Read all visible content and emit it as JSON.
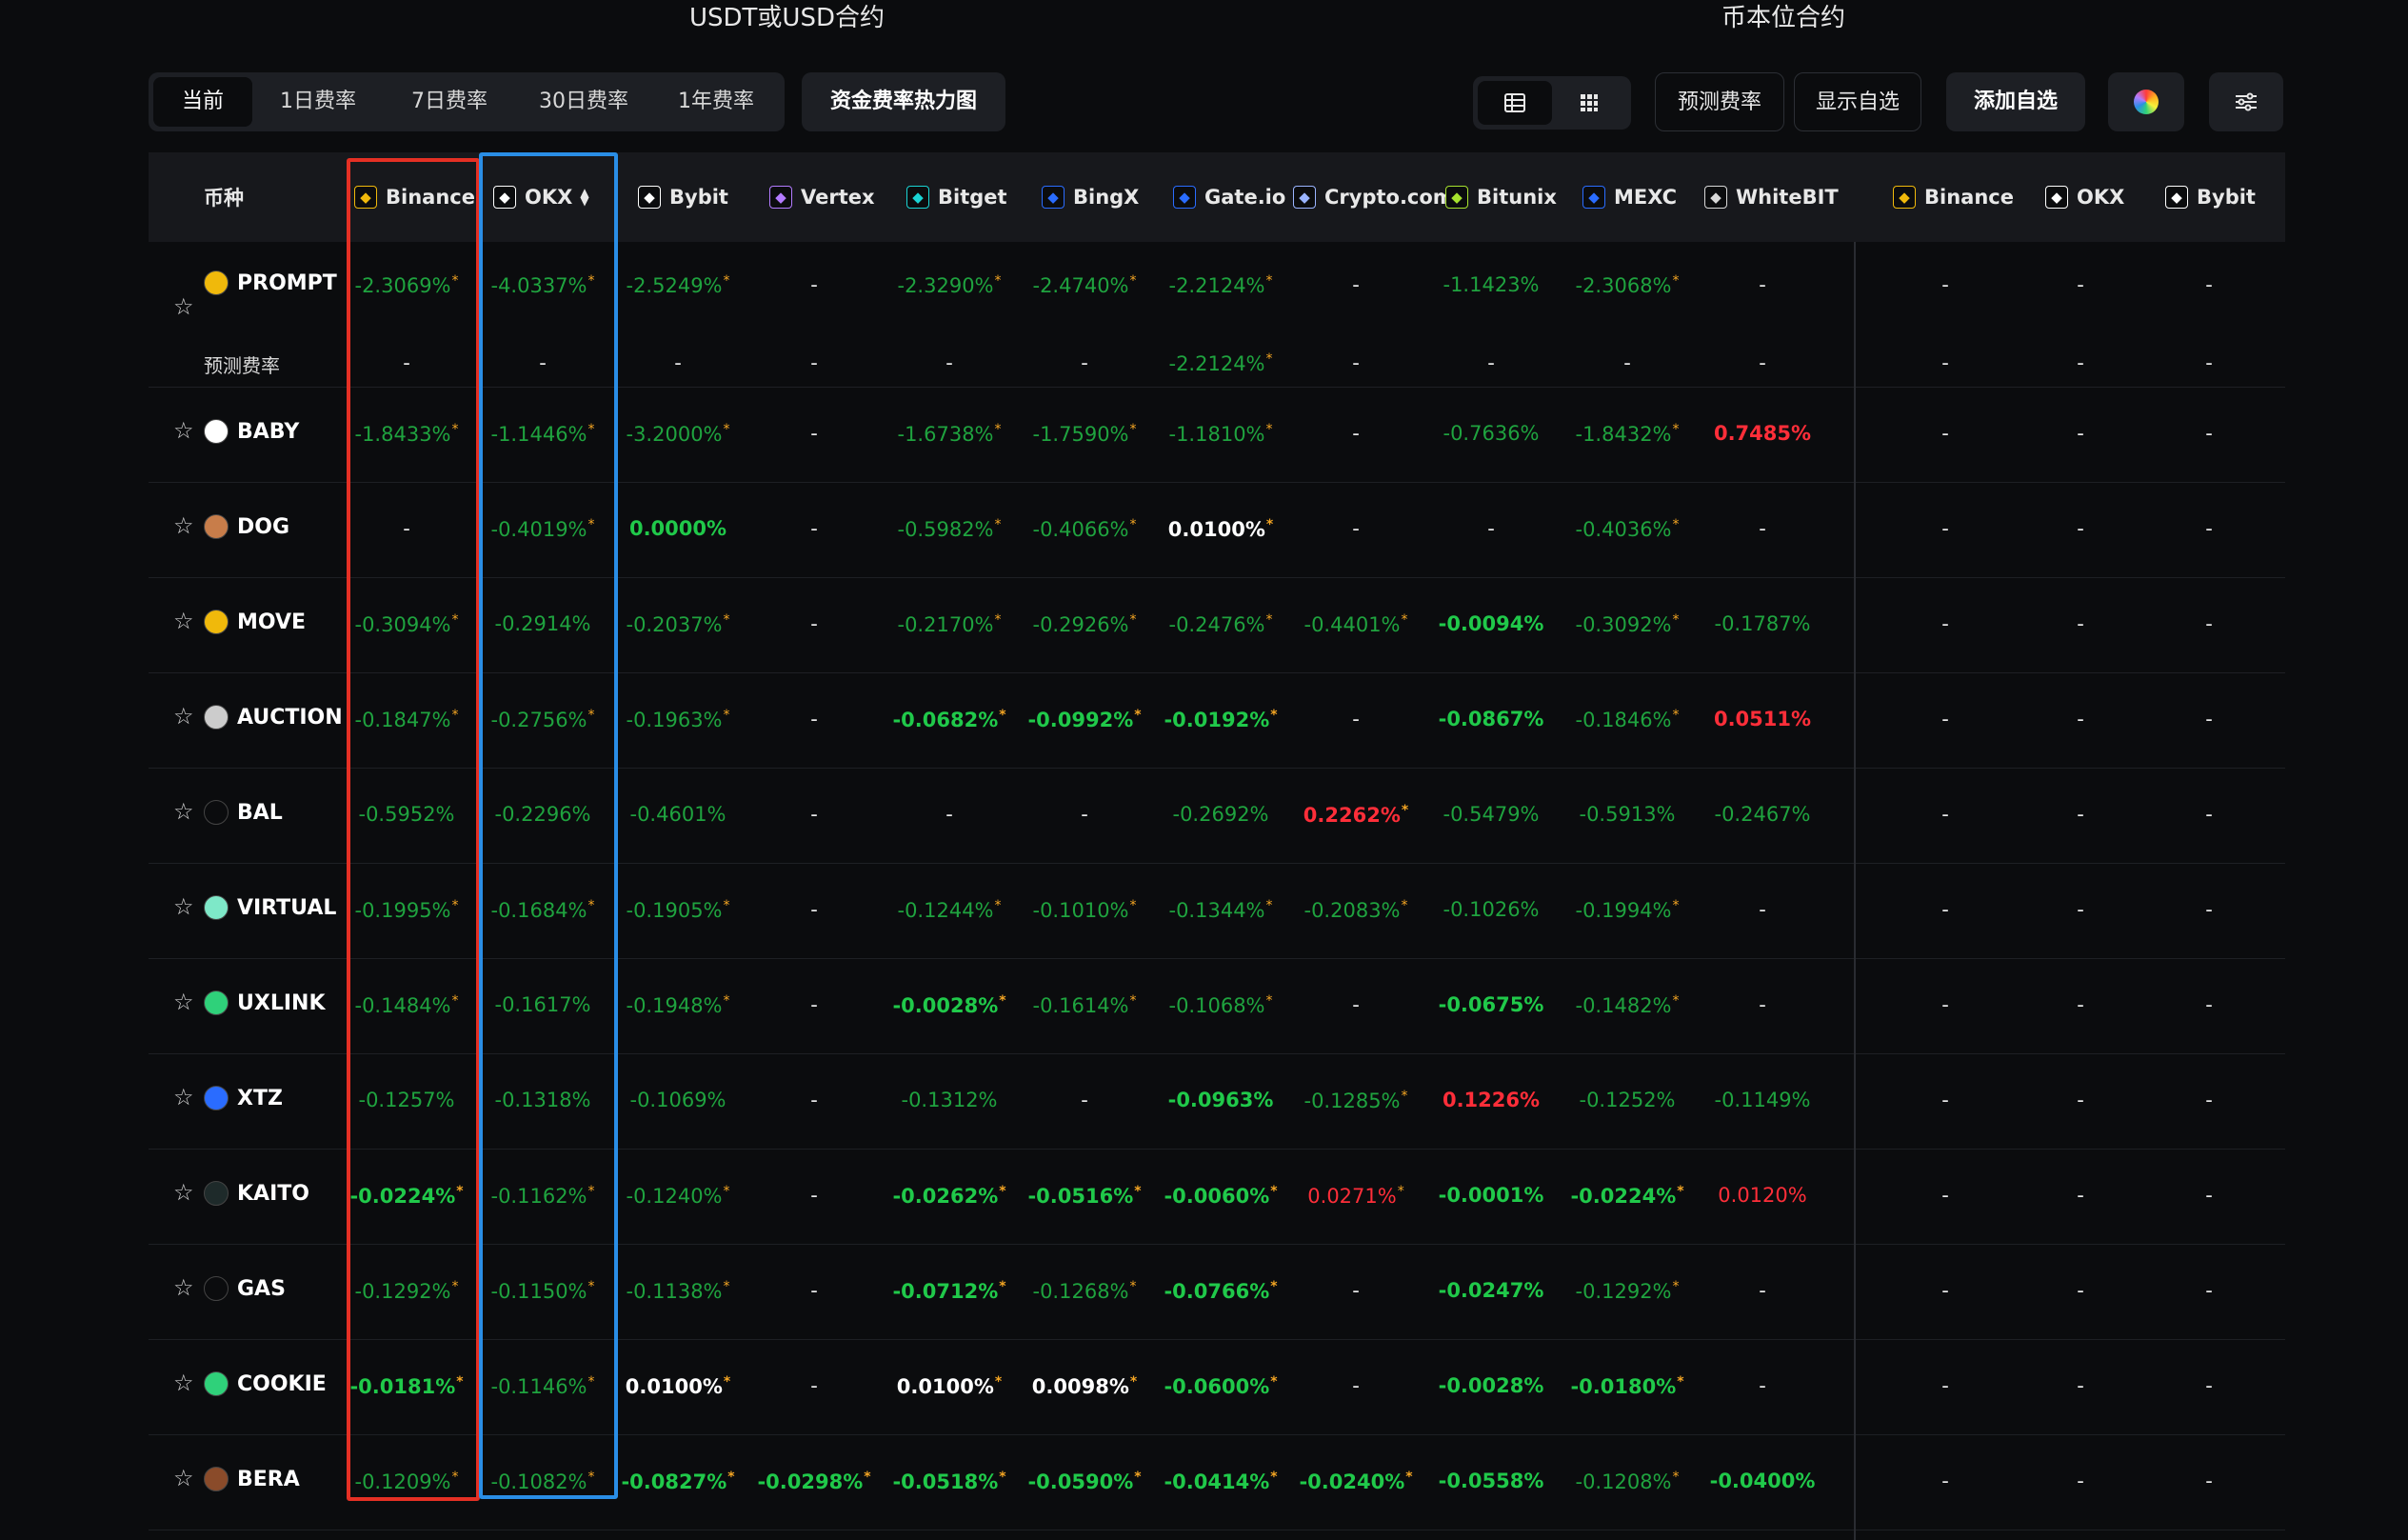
{
  "sections": {
    "usdt": "USDT或USD合约",
    "coin": "币本位合约"
  },
  "tabs": [
    "当前",
    "1日费率",
    "7日费率",
    "30日费率",
    "1年费率"
  ],
  "heatmap_button": "资金费率热力图",
  "buttons": {
    "predict": "预测费率",
    "show_fav": "显示自选",
    "add_fav": "添加自选"
  },
  "header": {
    "coin_label": "币种",
    "exchanges": [
      {
        "name": "Binance",
        "icon": "binance-icon",
        "color": "#f0b90b"
      },
      {
        "name": "OKX",
        "icon": "okx-icon",
        "color": "#ffffff"
      },
      {
        "name": "Bybit",
        "icon": "bybit-icon",
        "color": "#ffffff"
      },
      {
        "name": "Vertex",
        "icon": "vertex-icon",
        "color": "#b37bff"
      },
      {
        "name": "Bitget",
        "icon": "bitget-icon",
        "color": "#1ad4d4"
      },
      {
        "name": "BingX",
        "icon": "bingx-icon",
        "color": "#2a6cff"
      },
      {
        "name": "Gate.io",
        "icon": "gateio-icon",
        "color": "#2a6cff"
      },
      {
        "name": "Crypto.com",
        "icon": "cryptocom-icon",
        "color": "#9ab4ff"
      },
      {
        "name": "Bitunix",
        "icon": "bitunix-icon",
        "color": "#a6e22e"
      },
      {
        "name": "MEXC",
        "icon": "mexc-icon",
        "color": "#2a6cff"
      },
      {
        "name": "WhiteBIT",
        "icon": "whitebit-icon",
        "color": "#d8d8d8"
      },
      {
        "name": "Binance",
        "icon": "binance-icon",
        "color": "#f0b90b"
      },
      {
        "name": "OKX",
        "icon": "okx-icon",
        "color": "#ffffff"
      },
      {
        "name": "Bybit",
        "icon": "bybit-icon",
        "color": "#ffffff"
      }
    ]
  },
  "predict_label": "预测费率",
  "rows": [
    {
      "coin": "PROMPT",
      "icon": "prompt-icon",
      "icon_color": "#f0b90b",
      "values": [
        [
          "-2.3069%",
          "g",
          1
        ],
        [
          "-4.0337%",
          "g",
          1
        ],
        [
          "-2.5249%",
          "g",
          1
        ],
        [
          "-",
          "d",
          0
        ],
        [
          "-2.3290%",
          "g",
          1
        ],
        [
          "-2.4740%",
          "g",
          1
        ],
        [
          "-2.2124%",
          "g",
          1
        ],
        [
          "-",
          "d",
          0
        ],
        [
          "-1.1423%",
          "g",
          0
        ],
        [
          "-2.3068%",
          "g",
          1
        ],
        [
          "-",
          "d",
          0
        ],
        [
          "-",
          "d",
          0
        ],
        [
          "-",
          "d",
          0
        ],
        [
          "-",
          "d",
          0
        ]
      ],
      "predict": [
        [
          "-",
          "d",
          0
        ],
        [
          "-",
          "d",
          0
        ],
        [
          "-",
          "d",
          0
        ],
        [
          "-",
          "d",
          0
        ],
        [
          "-",
          "d",
          0
        ],
        [
          "-",
          "d",
          0
        ],
        [
          "-2.2124%",
          "g",
          1
        ],
        [
          "-",
          "d",
          0
        ],
        [
          "-",
          "d",
          0
        ],
        [
          "-",
          "d",
          0
        ],
        [
          "-",
          "d",
          0
        ],
        [
          "-",
          "d",
          0
        ],
        [
          "-",
          "d",
          0
        ],
        [
          "-",
          "d",
          0
        ]
      ]
    },
    {
      "coin": "BABY",
      "icon": "baby-icon",
      "icon_color": "#ffffff",
      "values": [
        [
          "-1.8433%",
          "g",
          1
        ],
        [
          "-1.1446%",
          "g",
          1
        ],
        [
          "-3.2000%",
          "g",
          1
        ],
        [
          "-",
          "d",
          0
        ],
        [
          "-1.6738%",
          "g",
          1
        ],
        [
          "-1.7590%",
          "g",
          1
        ],
        [
          "-1.1810%",
          "g",
          1
        ],
        [
          "-",
          "d",
          0
        ],
        [
          "-0.7636%",
          "g",
          0
        ],
        [
          "-1.8432%",
          "g",
          1
        ],
        [
          "0.7485%",
          "rb",
          0
        ],
        [
          "-",
          "d",
          0
        ],
        [
          "-",
          "d",
          0
        ],
        [
          "-",
          "d",
          0
        ]
      ]
    },
    {
      "coin": "DOG",
      "icon": "dog-icon",
      "icon_color": "#c87d4a",
      "values": [
        [
          "-",
          "d",
          0
        ],
        [
          "-0.4019%",
          "g",
          1
        ],
        [
          "0.0000%",
          "gb",
          0
        ],
        [
          "-",
          "d",
          0
        ],
        [
          "-0.5982%",
          "g",
          1
        ],
        [
          "-0.4066%",
          "g",
          1
        ],
        [
          "0.0100%",
          "w",
          1
        ],
        [
          "-",
          "d",
          0
        ],
        [
          "-",
          "d",
          0
        ],
        [
          "-0.4036%",
          "g",
          1
        ],
        [
          "-",
          "d",
          0
        ],
        [
          "-",
          "d",
          0
        ],
        [
          "-",
          "d",
          0
        ],
        [
          "-",
          "d",
          0
        ]
      ]
    },
    {
      "coin": "MOVE",
      "icon": "move-icon",
      "icon_color": "#f0b90b",
      "values": [
        [
          "-0.3094%",
          "g",
          1
        ],
        [
          "-0.2914%",
          "g",
          0
        ],
        [
          "-0.2037%",
          "g",
          1
        ],
        [
          "-",
          "d",
          0
        ],
        [
          "-0.2170%",
          "g",
          1
        ],
        [
          "-0.2926%",
          "g",
          1
        ],
        [
          "-0.2476%",
          "g",
          1
        ],
        [
          "-0.4401%",
          "g",
          1
        ],
        [
          "-0.0094%",
          "gb",
          0
        ],
        [
          "-0.3092%",
          "g",
          1
        ],
        [
          "-0.1787%",
          "g",
          0
        ],
        [
          "-",
          "d",
          0
        ],
        [
          "-",
          "d",
          0
        ],
        [
          "-",
          "d",
          0
        ]
      ]
    },
    {
      "coin": "AUCTION",
      "icon": "auction-icon",
      "icon_color": "#cccccc",
      "values": [
        [
          "-0.1847%",
          "g",
          1
        ],
        [
          "-0.2756%",
          "g",
          1
        ],
        [
          "-0.1963%",
          "g",
          1
        ],
        [
          "-",
          "d",
          0
        ],
        [
          "-0.0682%",
          "gb",
          1
        ],
        [
          "-0.0992%",
          "gb",
          1
        ],
        [
          "-0.0192%",
          "gb",
          1
        ],
        [
          "-",
          "d",
          0
        ],
        [
          "-0.0867%",
          "gb",
          0
        ],
        [
          "-0.1846%",
          "g",
          1
        ],
        [
          "0.0511%",
          "rb",
          0
        ],
        [
          "-",
          "d",
          0
        ],
        [
          "-",
          "d",
          0
        ],
        [
          "-",
          "d",
          0
        ]
      ]
    },
    {
      "coin": "BAL",
      "icon": "bal-icon",
      "icon_color": "#0b0c0e",
      "values": [
        [
          "-0.5952%",
          "g",
          0
        ],
        [
          "-0.2296%",
          "g",
          0
        ],
        [
          "-0.4601%",
          "g",
          0
        ],
        [
          "-",
          "d",
          0
        ],
        [
          "-",
          "d",
          0
        ],
        [
          "-",
          "d",
          0
        ],
        [
          "-0.2692%",
          "g",
          0
        ],
        [
          "0.2262%",
          "rb",
          1
        ],
        [
          "-0.5479%",
          "g",
          0
        ],
        [
          "-0.5913%",
          "g",
          0
        ],
        [
          "-0.2467%",
          "g",
          0
        ],
        [
          "-",
          "d",
          0
        ],
        [
          "-",
          "d",
          0
        ],
        [
          "-",
          "d",
          0
        ]
      ]
    },
    {
      "coin": "VIRTUAL",
      "icon": "virtual-icon",
      "icon_color": "#7ee8c8",
      "values": [
        [
          "-0.1995%",
          "g",
          1
        ],
        [
          "-0.1684%",
          "g",
          1
        ],
        [
          "-0.1905%",
          "g",
          1
        ],
        [
          "-",
          "d",
          0
        ],
        [
          "-0.1244%",
          "g",
          1
        ],
        [
          "-0.1010%",
          "g",
          1
        ],
        [
          "-0.1344%",
          "g",
          1
        ],
        [
          "-0.2083%",
          "g",
          1
        ],
        [
          "-0.1026%",
          "g",
          0
        ],
        [
          "-0.1994%",
          "g",
          1
        ],
        [
          "-",
          "d",
          0
        ],
        [
          "-",
          "d",
          0
        ],
        [
          "-",
          "d",
          0
        ],
        [
          "-",
          "d",
          0
        ]
      ]
    },
    {
      "coin": "UXLINK",
      "icon": "uxlink-icon",
      "icon_color": "#2fd17a",
      "values": [
        [
          "-0.1484%",
          "g",
          1
        ],
        [
          "-0.1617%",
          "g",
          0
        ],
        [
          "-0.1948%",
          "g",
          1
        ],
        [
          "-",
          "d",
          0
        ],
        [
          "-0.0028%",
          "gb",
          1
        ],
        [
          "-0.1614%",
          "g",
          1
        ],
        [
          "-0.1068%",
          "g",
          1
        ],
        [
          "-",
          "d",
          0
        ],
        [
          "-0.0675%",
          "gb",
          0
        ],
        [
          "-0.1482%",
          "g",
          1
        ],
        [
          "-",
          "d",
          0
        ],
        [
          "-",
          "d",
          0
        ],
        [
          "-",
          "d",
          0
        ],
        [
          "-",
          "d",
          0
        ]
      ]
    },
    {
      "coin": "XTZ",
      "icon": "xtz-icon",
      "icon_color": "#2a6cff",
      "values": [
        [
          "-0.1257%",
          "g",
          0
        ],
        [
          "-0.1318%",
          "g",
          0
        ],
        [
          "-0.1069%",
          "g",
          0
        ],
        [
          "-",
          "d",
          0
        ],
        [
          "-0.1312%",
          "g",
          0
        ],
        [
          "-",
          "d",
          0
        ],
        [
          "-0.0963%",
          "gb",
          0
        ],
        [
          "-0.1285%",
          "g",
          1
        ],
        [
          "0.1226%",
          "rb",
          0
        ],
        [
          "-0.1252%",
          "g",
          0
        ],
        [
          "-0.1149%",
          "g",
          0
        ],
        [
          "-",
          "d",
          0
        ],
        [
          "-",
          "d",
          0
        ],
        [
          "-",
          "d",
          0
        ]
      ]
    },
    {
      "coin": "KAITO",
      "icon": "kaito-icon",
      "icon_color": "#1e2a2a",
      "values": [
        [
          "-0.0224%",
          "gb",
          1
        ],
        [
          "-0.1162%",
          "g",
          1
        ],
        [
          "-0.1240%",
          "g",
          1
        ],
        [
          "-",
          "d",
          0
        ],
        [
          "-0.0262%",
          "gb",
          1
        ],
        [
          "-0.0516%",
          "gb",
          1
        ],
        [
          "-0.0060%",
          "gb",
          1
        ],
        [
          "0.0271%",
          "r",
          1
        ],
        [
          "-0.0001%",
          "gb",
          0
        ],
        [
          "-0.0224%",
          "gb",
          1
        ],
        [
          "0.0120%",
          "r",
          0
        ],
        [
          "-",
          "d",
          0
        ],
        [
          "-",
          "d",
          0
        ],
        [
          "-",
          "d",
          0
        ]
      ]
    },
    {
      "coin": "GAS",
      "icon": "gas-icon",
      "icon_color": "#0b0c0e",
      "values": [
        [
          "-0.1292%",
          "g",
          1
        ],
        [
          "-0.1150%",
          "g",
          1
        ],
        [
          "-0.1138%",
          "g",
          1
        ],
        [
          "-",
          "d",
          0
        ],
        [
          "-0.0712%",
          "gb",
          1
        ],
        [
          "-0.1268%",
          "g",
          1
        ],
        [
          "-0.0766%",
          "gb",
          1
        ],
        [
          "-",
          "d",
          0
        ],
        [
          "-0.0247%",
          "gb",
          0
        ],
        [
          "-0.1292%",
          "g",
          1
        ],
        [
          "-",
          "d",
          0
        ],
        [
          "-",
          "d",
          0
        ],
        [
          "-",
          "d",
          0
        ],
        [
          "-",
          "d",
          0
        ]
      ]
    },
    {
      "coin": "COOKIE",
      "icon": "cookie-icon",
      "icon_color": "#2fd17a",
      "values": [
        [
          "-0.0181%",
          "gb",
          1
        ],
        [
          "-0.1146%",
          "g",
          1
        ],
        [
          "0.0100%",
          "w",
          1
        ],
        [
          "-",
          "d",
          0
        ],
        [
          "0.0100%",
          "w",
          1
        ],
        [
          "0.0098%",
          "w",
          1
        ],
        [
          "-0.0600%",
          "gb",
          1
        ],
        [
          "-",
          "d",
          0
        ],
        [
          "-0.0028%",
          "gb",
          0
        ],
        [
          "-0.0180%",
          "gb",
          1
        ],
        [
          "-",
          "d",
          0
        ],
        [
          "-",
          "d",
          0
        ],
        [
          "-",
          "d",
          0
        ],
        [
          "-",
          "d",
          0
        ]
      ]
    },
    {
      "coin": "BERA",
      "icon": "bera-icon",
      "icon_color": "#8a4b2a",
      "values": [
        [
          "-0.1209%",
          "g",
          1
        ],
        [
          "-0.1082%",
          "g",
          1
        ],
        [
          "-0.0827%",
          "gb",
          1
        ],
        [
          "-0.0298%",
          "gb",
          1
        ],
        [
          "-0.0518%",
          "gb",
          1
        ],
        [
          "-0.0590%",
          "gb",
          1
        ],
        [
          "-0.0414%",
          "gb",
          1
        ],
        [
          "-0.0240%",
          "gb",
          1
        ],
        [
          "-0.0558%",
          "gb",
          0
        ],
        [
          "-0.1208%",
          "g",
          1
        ],
        [
          "-0.0400%",
          "gb",
          0
        ],
        [
          "-",
          "d",
          0
        ],
        [
          "-",
          "d",
          0
        ],
        [
          "-",
          "d",
          0
        ]
      ]
    }
  ]
}
